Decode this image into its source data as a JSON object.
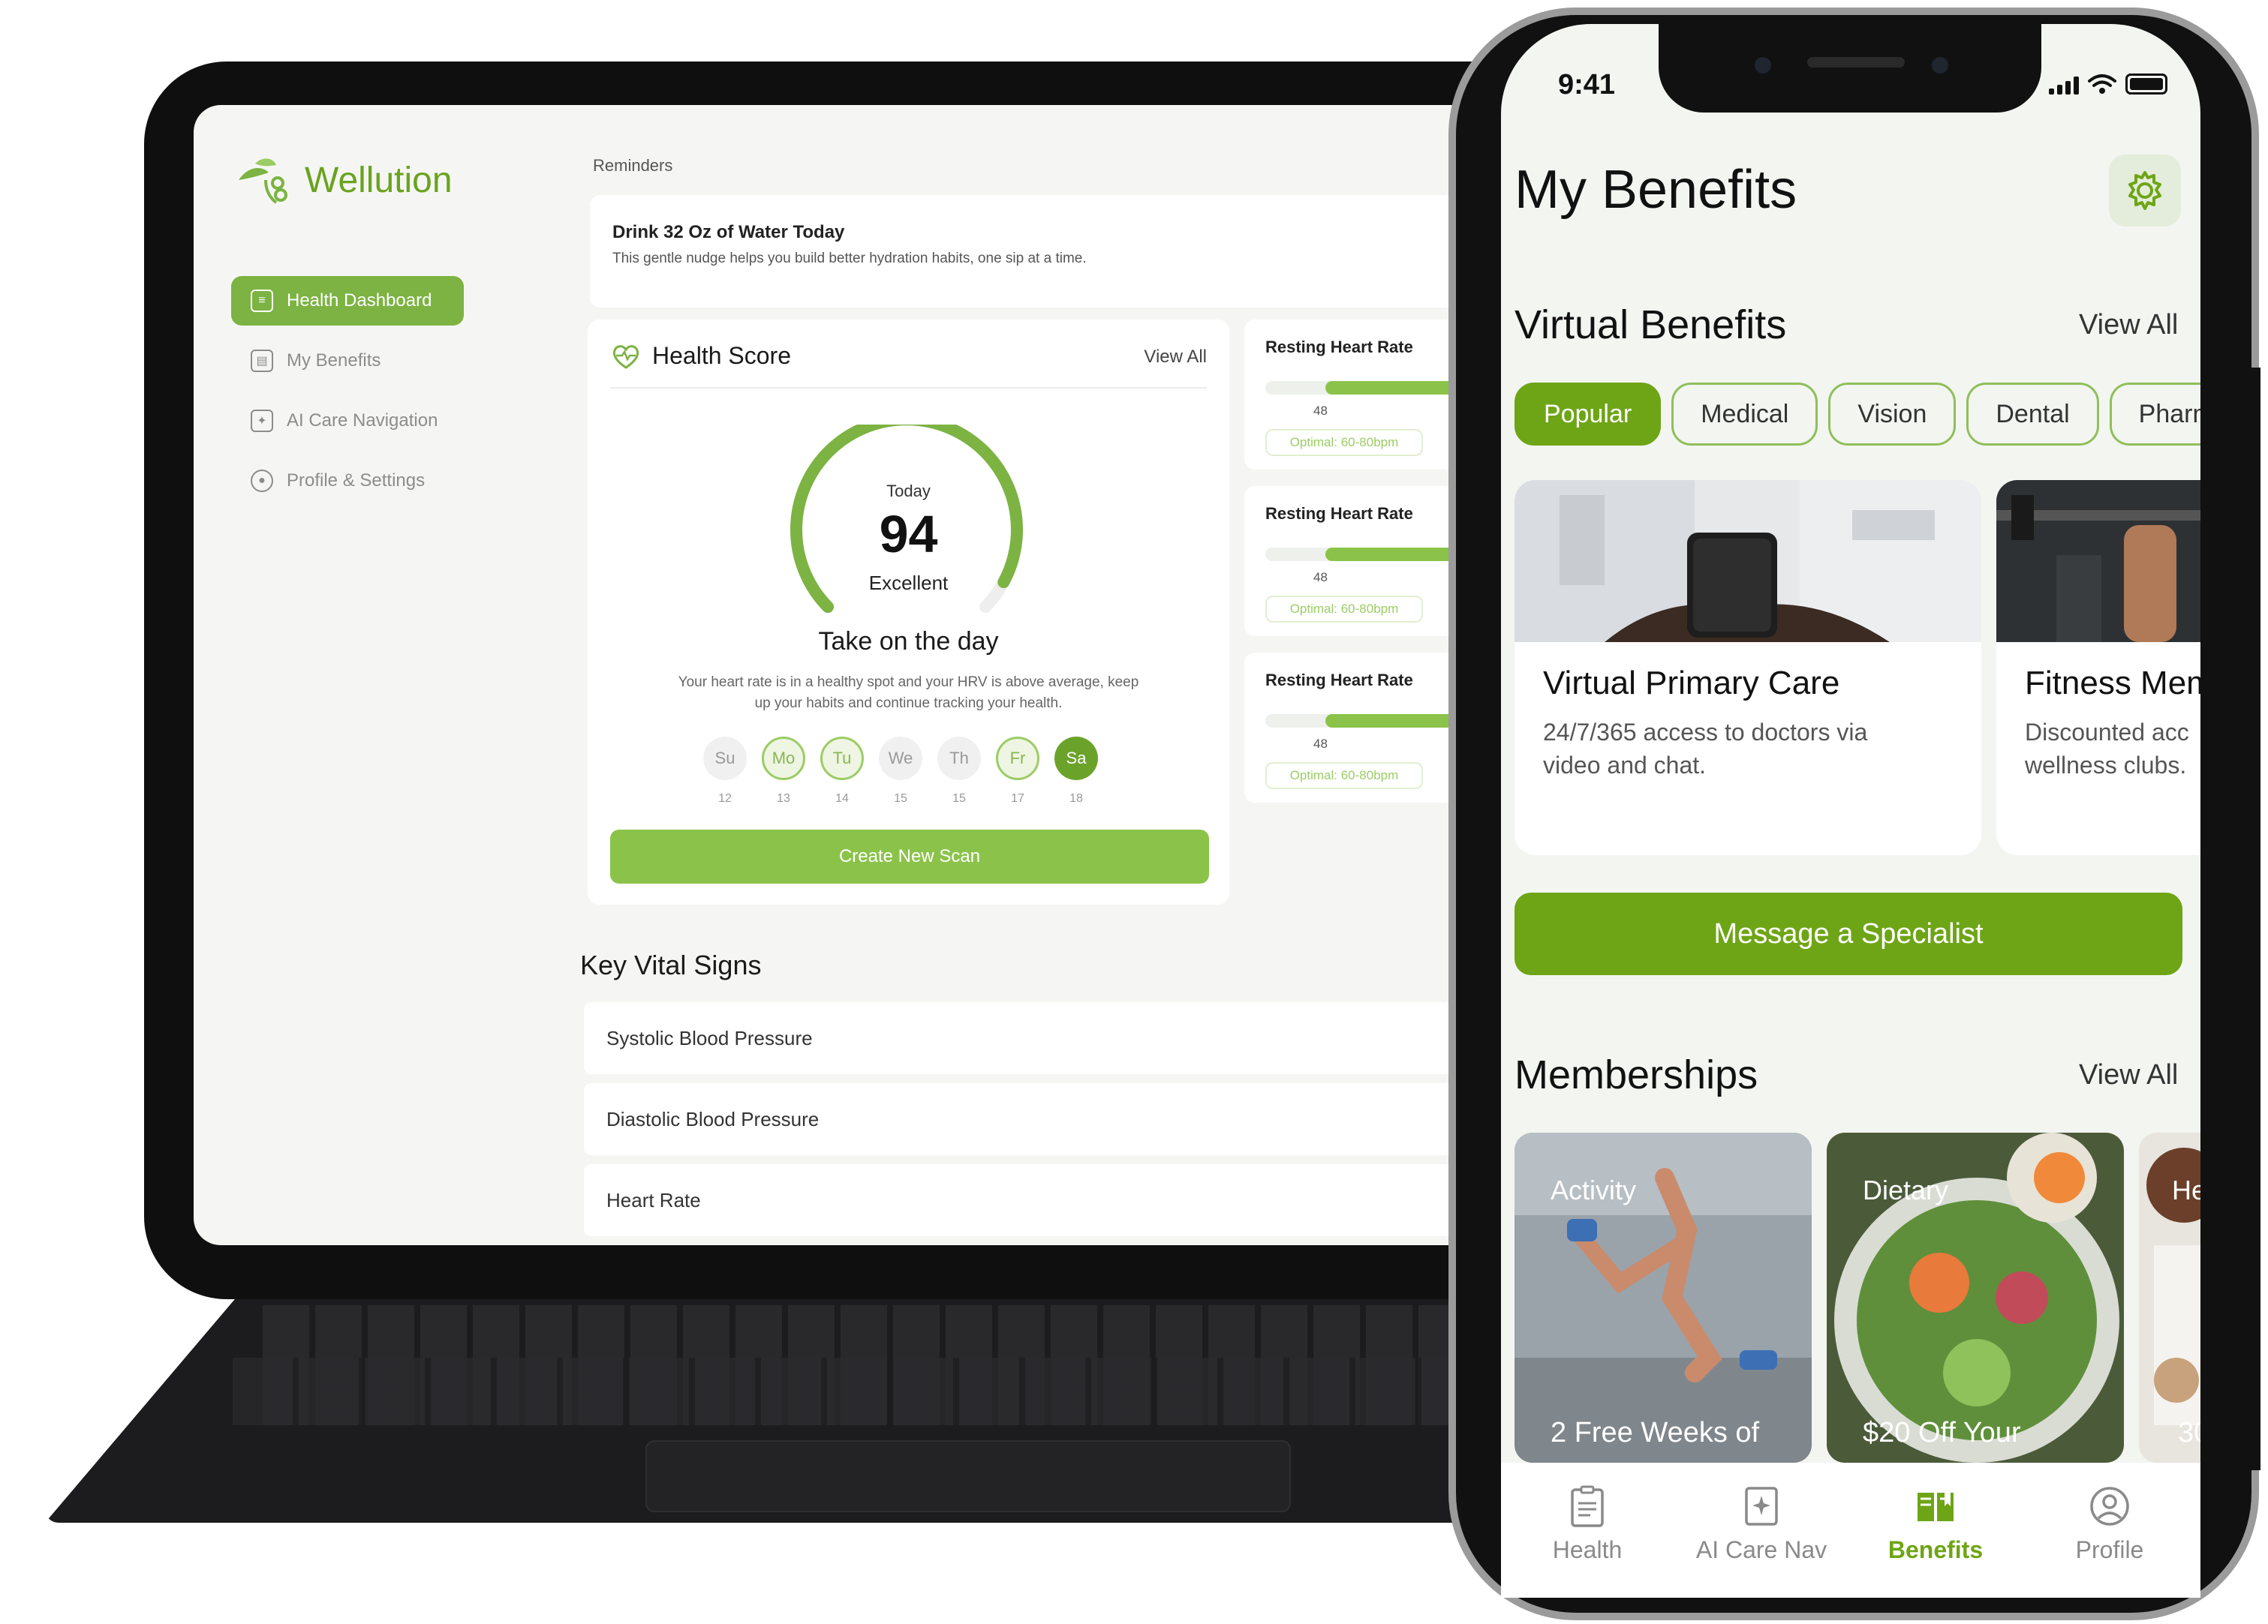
{
  "tablet": {
    "brand": "Wellution",
    "nav": [
      {
        "label": "Health Dashboard",
        "active": true
      },
      {
        "label": "My Benefits",
        "active": false
      },
      {
        "label": "AI Care Navigation",
        "active": false
      },
      {
        "label": "Profile & Settings",
        "active": false
      }
    ],
    "reminders": {
      "section_label": "Reminders",
      "title": "Drink 32 Oz of Water Today",
      "subtitle": "This gentle nudge helps you build better hydration habits, one sip at a time."
    },
    "health_score": {
      "title": "Health Score",
      "view_all": "View All",
      "today_label": "Today",
      "score": "94",
      "score_fraction": 0.94,
      "rating": "Excellent",
      "headline": "Take on the day",
      "description": "Your heart rate is in a healthy spot and your HRV is above average, keep up your habits and continue tracking your health.",
      "days": [
        {
          "abbr": "Su",
          "date": "12",
          "state": "none"
        },
        {
          "abbr": "Mo",
          "date": "13",
          "state": "ring"
        },
        {
          "abbr": "Tu",
          "date": "14",
          "state": "ring"
        },
        {
          "abbr": "We",
          "date": "15",
          "state": "none"
        },
        {
          "abbr": "Th",
          "date": "15",
          "state": "none"
        },
        {
          "abbr": "Fr",
          "date": "17",
          "state": "ring"
        },
        {
          "abbr": "Sa",
          "date": "18",
          "state": "fill"
        }
      ],
      "scan_button": "Create New Scan"
    },
    "vitals_cards": [
      {
        "title": "Resting Heart Rate",
        "value": "48",
        "optimal": "Optimal: 60-80bpm"
      },
      {
        "title": "Resting Heart Rate",
        "value": "48",
        "optimal": "Optimal: 60-80bpm"
      },
      {
        "title": "Resting Heart Rate",
        "value": "48",
        "optimal": "Optimal: 60-80bpm"
      }
    ],
    "key_vitals": {
      "title": "Key Vital Signs",
      "rows": [
        "Systolic Blood Pressure",
        "Diastolic Blood Pressure",
        "Heart Rate"
      ]
    }
  },
  "phone": {
    "status": {
      "time": "9:41"
    },
    "title": "My Benefits",
    "virtual_benefits": {
      "title": "Virtual Benefits",
      "view_all": "View All",
      "chips": [
        "Popular",
        "Medical",
        "Vision",
        "Dental",
        "Pharma"
      ],
      "active_chip": "Popular",
      "cards": [
        {
          "name": "Virtual Primary Care",
          "desc_line1": "24/7/365 access to doctors via",
          "desc_line2": "video and chat."
        },
        {
          "name": "Fitness Mem",
          "desc_line1": "Discounted acc",
          "desc_line2": "wellness clubs."
        }
      ]
    },
    "message_button": "Message a Specialist",
    "memberships": {
      "title": "Memberships",
      "view_all": "View All",
      "cards": [
        {
          "label": "Activity",
          "caption": "2 Free Weeks of"
        },
        {
          "label": "Dietary",
          "caption": "$20 Off Your"
        },
        {
          "label": "He",
          "caption": "30"
        }
      ]
    },
    "tabbar": [
      {
        "label": "Health",
        "icon": "clipboard-icon",
        "active": false
      },
      {
        "label": "AI Care Nav",
        "icon": "sparkle-doc-icon",
        "active": false
      },
      {
        "label": "Benefits",
        "icon": "book-icon",
        "active": true
      },
      {
        "label": "Profile",
        "icon": "user-circle-icon",
        "active": false
      }
    ]
  },
  "colors": {
    "brand_green": "#6ea516",
    "light_green": "#8bc34a",
    "chip_border": "#8fbf5a"
  }
}
